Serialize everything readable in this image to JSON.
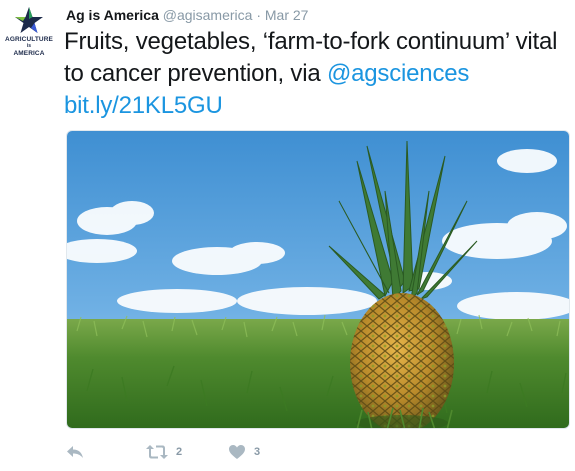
{
  "account": {
    "logo_line1": "AGRICULTURE",
    "logo_line2": "is",
    "logo_line3": "AMERICA",
    "name": "Ag is America",
    "handle": "@agisamerica",
    "separator": "·",
    "date": "Mar 27"
  },
  "tweet": {
    "text": "Fruits, vegetables, ‘farm-to-fork continuum’ vital to cancer prevention, via ",
    "mention": "@agsciences",
    "url": "bit.ly/21KL5GU"
  },
  "media": {
    "subject": "pineapple on grass under blue sky"
  },
  "actions": {
    "reply_icon": "reply-icon",
    "retweet_icon": "retweet-icon",
    "retweet_count": "2",
    "like_icon": "heart-icon",
    "like_count": "3"
  },
  "colors": {
    "link": "#1b95e0",
    "muted": "#8899a6",
    "icon": "#aab8c2"
  }
}
